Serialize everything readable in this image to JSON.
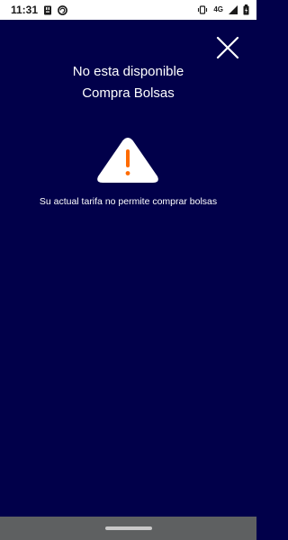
{
  "status_bar": {
    "time": "11:31",
    "network": "4G",
    "icons": [
      "usb-icon",
      "sync-icon",
      "vibrate-icon",
      "signal-icon",
      "battery-icon"
    ]
  },
  "dialog": {
    "title_line1": "No esta disponible",
    "title_line2": "Compra Bolsas",
    "message": "Su actual tarifa no permite comprar bolsas",
    "close_icon": "close-icon",
    "alert_icon": "warning-icon"
  },
  "colors": {
    "background": "#01004a",
    "warning_fill": "#ffffff",
    "warning_mark": "#ff6b00",
    "nav_bar": "#5e6061"
  }
}
